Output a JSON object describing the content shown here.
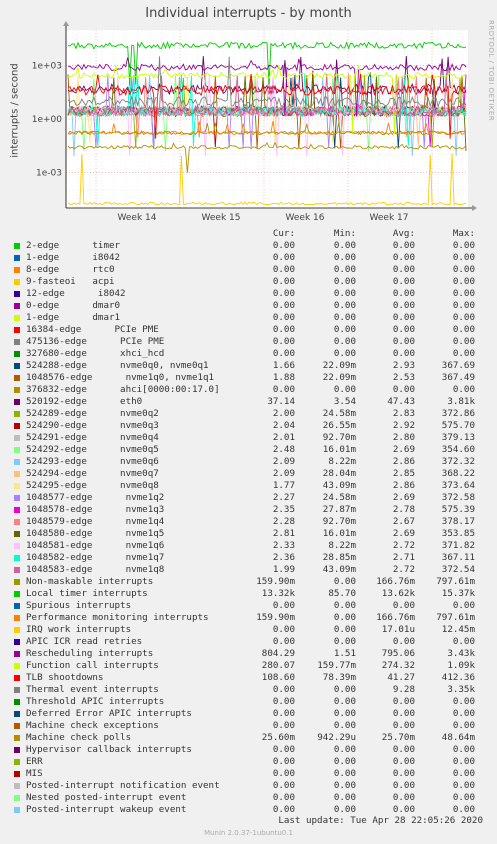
{
  "title": "Individual interrupts - by month",
  "sidebar_text": "RRDTOOL / TOBI OETIKER",
  "ylabel": "interrupts / second",
  "legend_headers": {
    "cur": "Cur:",
    "min": "Min:",
    "avg": "Avg:",
    "max": "Max:"
  },
  "last_update": "Last update: Tue Apr 28 22:05:26 2020",
  "footer": "Munin 2.0.37-1ubuntu0.1",
  "chart_data": {
    "type": "line",
    "title": "Individual interrupts - by month",
    "ylabel": "interrupts / second",
    "yscale": "log",
    "ytick_labels": [
      "1e+03",
      "1e+00",
      "1e-03"
    ],
    "yticks": [
      1000,
      1,
      0.001
    ],
    "ylim": [
      1e-05,
      100000
    ],
    "xtick_labels": [
      "Week 14",
      "Week 15",
      "Week 16",
      "Week 17"
    ],
    "grid": true,
    "series": [
      {
        "name": "2-edge      timer",
        "color": "#00cc00",
        "cur": "0.00",
        "min": "0.00",
        "avg": "0.00",
        "max": "0.00"
      },
      {
        "name": "1-edge      i8042",
        "color": "#0066b3",
        "cur": "0.00",
        "min": "0.00",
        "avg": "0.00",
        "max": "0.00"
      },
      {
        "name": "8-edge      rtc0",
        "color": "#ff8000",
        "cur": "0.00",
        "min": "0.00",
        "avg": "0.00",
        "max": "0.00"
      },
      {
        "name": "9-fasteoi   acpi",
        "color": "#ffcc00",
        "cur": "0.00",
        "min": "0.00",
        "avg": "0.00",
        "max": "0.00"
      },
      {
        "name": "12-edge      i8042",
        "color": "#330099",
        "cur": "0.00",
        "min": "0.00",
        "avg": "0.00",
        "max": "0.00"
      },
      {
        "name": "0-edge      dmar0",
        "color": "#990099",
        "cur": "0.00",
        "min": "0.00",
        "avg": "0.00",
        "max": "0.00"
      },
      {
        "name": "1-edge      dmar1",
        "color": "#ccff00",
        "cur": "0.00",
        "min": "0.00",
        "avg": "0.00",
        "max": "0.00"
      },
      {
        "name": "16384-edge      PCIe PME",
        "color": "#ff0000",
        "cur": "0.00",
        "min": "0.00",
        "avg": "0.00",
        "max": "0.00"
      },
      {
        "name": "475136-edge      PCIe PME",
        "color": "#808080",
        "cur": "0.00",
        "min": "0.00",
        "avg": "0.00",
        "max": "0.00"
      },
      {
        "name": "327680-edge      xhci_hcd",
        "color": "#008f00",
        "cur": "0.00",
        "min": "0.00",
        "avg": "0.00",
        "max": "0.00"
      },
      {
        "name": "524288-edge      nvme0q0, nvme0q1",
        "color": "#00487d",
        "cur": "1.66",
        "min": "22.09m",
        "avg": "2.93",
        "max": "367.69"
      },
      {
        "name": "1048576-edge      nvme1q0, nvme1q1",
        "color": "#b35a00",
        "cur": "1.88",
        "min": "22.09m",
        "avg": "2.53",
        "max": "367.49"
      },
      {
        "name": "376832-edge      ahci[0000:00:17.0]",
        "color": "#b38f00",
        "cur": "0.00",
        "min": "0.00",
        "avg": "0.00",
        "max": "0.00"
      },
      {
        "name": "520192-edge      eth0",
        "color": "#6b006b",
        "cur": "37.14",
        "min": "3.54",
        "avg": "47.43",
        "max": "3.81k"
      },
      {
        "name": "524289-edge      nvme0q2",
        "color": "#8fb300",
        "cur": "2.00",
        "min": "24.58m",
        "avg": "2.83",
        "max": "372.86"
      },
      {
        "name": "524290-edge      nvme0q3",
        "color": "#b30000",
        "cur": "2.04",
        "min": "26.55m",
        "avg": "2.92",
        "max": "575.70"
      },
      {
        "name": "524291-edge      nvme0q4",
        "color": "#bebebe",
        "cur": "2.01",
        "min": "92.70m",
        "avg": "2.80",
        "max": "379.13"
      },
      {
        "name": "524292-edge      nvme0q5",
        "color": "#80ff80",
        "cur": "2.48",
        "min": "16.01m",
        "avg": "2.69",
        "max": "354.60"
      },
      {
        "name": "524293-edge      nvme0q6",
        "color": "#80c9ff",
        "cur": "2.09",
        "min": "8.22m",
        "avg": "2.86",
        "max": "372.32"
      },
      {
        "name": "524294-edge      nvme0q7",
        "color": "#ffc080",
        "cur": "2.09",
        "min": "28.04m",
        "avg": "2.85",
        "max": "368.22"
      },
      {
        "name": "524295-edge      nvme0q8",
        "color": "#ffe680",
        "cur": "1.77",
        "min": "43.09m",
        "avg": "2.86",
        "max": "373.64"
      },
      {
        "name": "1048577-edge      nvme1q2",
        "color": "#aa80ff",
        "cur": "2.27",
        "min": "24.58m",
        "avg": "2.69",
        "max": "372.58"
      },
      {
        "name": "1048578-edge      nvme1q3",
        "color": "#ee00cc",
        "cur": "2.35",
        "min": "27.87m",
        "avg": "2.78",
        "max": "575.39"
      },
      {
        "name": "1048579-edge      nvme1q4",
        "color": "#ff8080",
        "cur": "2.28",
        "min": "92.70m",
        "avg": "2.67",
        "max": "378.17"
      },
      {
        "name": "1048580-edge      nvme1q5",
        "color": "#666600",
        "cur": "2.81",
        "min": "16.01m",
        "avg": "2.69",
        "max": "353.85"
      },
      {
        "name": "1048581-edge      nvme1q6",
        "color": "#ffbfff",
        "cur": "2.33",
        "min": "8.22m",
        "avg": "2.72",
        "max": "371.82"
      },
      {
        "name": "1048582-edge      nvme1q7",
        "color": "#00ffcc",
        "cur": "2.36",
        "min": "28.85m",
        "avg": "2.71",
        "max": "367.11"
      },
      {
        "name": "1048583-edge      nvme1q8",
        "color": "#cc6699",
        "cur": "1.99",
        "min": "43.09m",
        "avg": "2.72",
        "max": "372.54"
      },
      {
        "name": "Non-maskable interrupts",
        "color": "#999900",
        "cur": "159.90m",
        "min": "0.00",
        "avg": "166.76m",
        "max": "797.61m"
      },
      {
        "name": "Local timer interrupts",
        "color": "#00cc00",
        "cur": "13.32k",
        "min": "85.70",
        "avg": "13.62k",
        "max": "15.37k"
      },
      {
        "name": "Spurious interrupts",
        "color": "#0066b3",
        "cur": "0.00",
        "min": "0.00",
        "avg": "0.00",
        "max": "0.00"
      },
      {
        "name": "Performance monitoring interrupts",
        "color": "#ff8000",
        "cur": "159.90m",
        "min": "0.00",
        "avg": "166.76m",
        "max": "797.61m"
      },
      {
        "name": "IRQ work interrupts",
        "color": "#ffcc00",
        "cur": "0.00",
        "min": "0.00",
        "avg": "17.01u",
        "max": "12.45m"
      },
      {
        "name": "APIC ICR read retries",
        "color": "#330099",
        "cur": "0.00",
        "min": "0.00",
        "avg": "0.00",
        "max": "0.00"
      },
      {
        "name": "Rescheduling interrupts",
        "color": "#990099",
        "cur": "804.29",
        "min": "1.51",
        "avg": "795.06",
        "max": "3.43k"
      },
      {
        "name": "Function call interrupts",
        "color": "#ccff00",
        "cur": "280.07",
        "min": "159.77m",
        "avg": "274.32",
        "max": "1.09k"
      },
      {
        "name": "TLB shootdowns",
        "color": "#ff0000",
        "cur": "108.60",
        "min": "78.39m",
        "avg": "41.27",
        "max": "412.36"
      },
      {
        "name": "Thermal event interrupts",
        "color": "#808080",
        "cur": "0.00",
        "min": "0.00",
        "avg": "9.28",
        "max": "3.35k"
      },
      {
        "name": "Threshold APIC interrupts",
        "color": "#008f00",
        "cur": "0.00",
        "min": "0.00",
        "avg": "0.00",
        "max": "0.00"
      },
      {
        "name": "Deferred Error APIC interrupts",
        "color": "#00487d",
        "cur": "0.00",
        "min": "0.00",
        "avg": "0.00",
        "max": "0.00"
      },
      {
        "name": "Machine check exceptions",
        "color": "#b35a00",
        "cur": "0.00",
        "min": "0.00",
        "avg": "0.00",
        "max": "0.00"
      },
      {
        "name": "Machine check polls",
        "color": "#b38f00",
        "cur": "25.60m",
        "min": "942.29u",
        "avg": "25.70m",
        "max": "48.64m"
      },
      {
        "name": "Hypervisor callback interrupts",
        "color": "#6b006b",
        "cur": "0.00",
        "min": "0.00",
        "avg": "0.00",
        "max": "0.00"
      },
      {
        "name": "ERR",
        "color": "#8fb300",
        "cur": "0.00",
        "min": "0.00",
        "avg": "0.00",
        "max": "0.00"
      },
      {
        "name": "MIS",
        "color": "#b30000",
        "cur": "0.00",
        "min": "0.00",
        "avg": "0.00",
        "max": "0.00"
      },
      {
        "name": "Posted-interrupt notification event",
        "color": "#bebebe",
        "cur": "0.00",
        "min": "0.00",
        "avg": "0.00",
        "max": "0.00"
      },
      {
        "name": "Nested posted-interrupt event",
        "color": "#80ff80",
        "cur": "0.00",
        "min": "0.00",
        "avg": "0.00",
        "max": "0.00"
      },
      {
        "name": "Posted-interrupt wakeup event",
        "color": "#80c9ff",
        "cur": "0.00",
        "min": "0.00",
        "avg": "0.00",
        "max": "0.00"
      }
    ]
  }
}
